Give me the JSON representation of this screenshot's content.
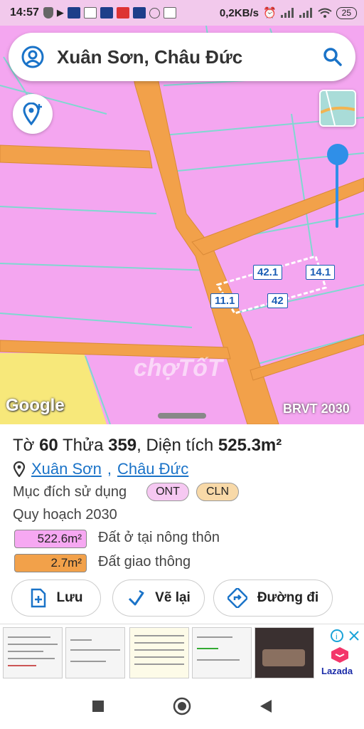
{
  "status_bar": {
    "time": "14:57",
    "network_speed": "0,2KB/s",
    "battery": "25"
  },
  "search": {
    "query": "Xuân Sơn, Châu Đức"
  },
  "map": {
    "parcel_labels": [
      "42.1",
      "14.1",
      "11.1",
      "42"
    ],
    "google_label": "Google",
    "plan_label": "BRVT 2030",
    "watermark": "chợTốT",
    "colors": {
      "residential": "#f4a6f0",
      "road": "#f2a14a",
      "perennial": "#f7e87a",
      "accent": "#2f8fe8"
    }
  },
  "info": {
    "title_parts": [
      "Tờ ",
      "60",
      " Thửa ",
      "359",
      ", Diện tích ",
      "525.3m²"
    ],
    "address_commune": "Xuân Sơn",
    "address_district": "Châu Đức",
    "purpose_label": "Mục đích sử dụng",
    "purpose_codes": [
      {
        "code": "ONT",
        "color": "#f6c8f2"
      },
      {
        "code": "CLN",
        "color": "#f8d9a8"
      }
    ],
    "plan_heading": "Quy hoạch 2030",
    "plan_items": [
      {
        "area": "522.6m²",
        "desc": "Đất ở tại nông thôn",
        "color": "#f6a8f2"
      },
      {
        "area": "2.7m²",
        "desc": "Đất giao thông",
        "color": "#f2a14a"
      }
    ]
  },
  "actions": {
    "save": "Lưu",
    "redraw": "Vẽ lại",
    "directions": "Đường đi"
  },
  "ad": {
    "brand": "Lazada"
  }
}
